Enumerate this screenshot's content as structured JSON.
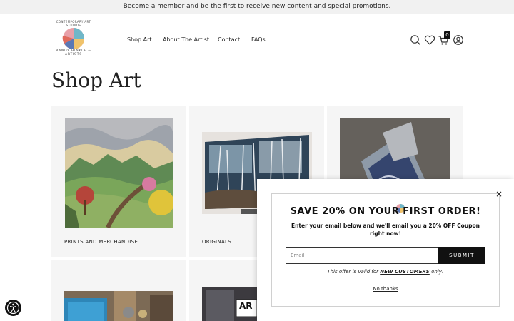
{
  "announcement": "Become a member and be the first to receive new content and special promotions.",
  "logo": {
    "top_text": "CONTEMPORARY ART STUDIOS",
    "bottom_text": "RANDY HINKLE & ARTISTS"
  },
  "nav": {
    "items": [
      "Shop Art",
      "About The Artist",
      "Contact",
      "FAQs"
    ]
  },
  "header_icons": [
    "search-icon",
    "heart-icon",
    "cart-icon",
    "account-icon"
  ],
  "cart_count": "0",
  "page_title": "Shop Art",
  "cards": [
    {
      "label": "PRINTS AND MERCHANDISE"
    },
    {
      "label": "ORIGINALS"
    },
    {
      "label": ""
    }
  ],
  "bottom_card_badge": "AR",
  "popup": {
    "headline": "SAVE 20% ON YOUR FIRST ORDER!",
    "subtext": "Enter your email below and we'll email you a 20% OFF Coupon right now!",
    "email_placeholder": "Email",
    "submit_label": "SUBMIT",
    "offer_prefix": "This offer is valid for",
    "offer_emph": "NEW CUSTOMERS",
    "offer_suffix": "only!",
    "no_thanks": "No thanks",
    "close_glyph": "×"
  }
}
